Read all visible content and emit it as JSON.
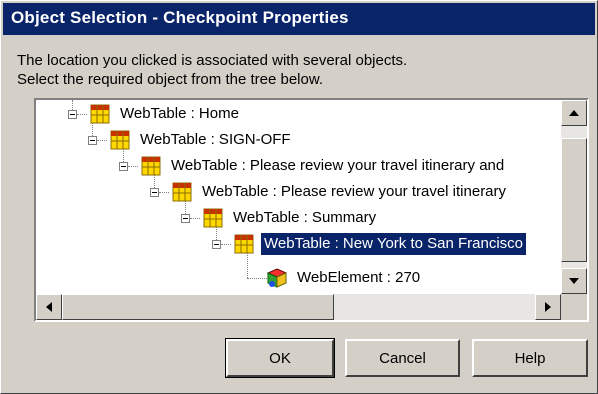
{
  "window": {
    "title": "Object Selection - Checkpoint Properties"
  },
  "description": {
    "line1": "The location you clicked is associated with several objects.",
    "line2": "Select the required object from the tree below."
  },
  "tree": {
    "nodes": [
      {
        "label": "WebTable : Home",
        "icon": "webtable-icon",
        "selected": false
      },
      {
        "label": "WebTable : SIGN-OFF",
        "icon": "webtable-icon",
        "selected": false
      },
      {
        "label": "WebTable : Please review your travel itinerary and",
        "icon": "webtable-icon",
        "selected": false
      },
      {
        "label": "WebTable : Please review your travel itinerary",
        "icon": "webtable-icon",
        "selected": false
      },
      {
        "label": "WebTable : Summary",
        "icon": "webtable-icon",
        "selected": false
      },
      {
        "label": "WebTable : New York to San Francisco",
        "icon": "webtable-icon",
        "selected": true
      },
      {
        "label": "WebElement : 270",
        "icon": "webelement-icon",
        "selected": false
      }
    ]
  },
  "buttons": {
    "ok": "OK",
    "cancel": "Cancel",
    "help": "Help"
  },
  "colors": {
    "titlebar": "#0a246a",
    "selection": "#0a246a",
    "dialog_bg": "#d4d0c8"
  }
}
